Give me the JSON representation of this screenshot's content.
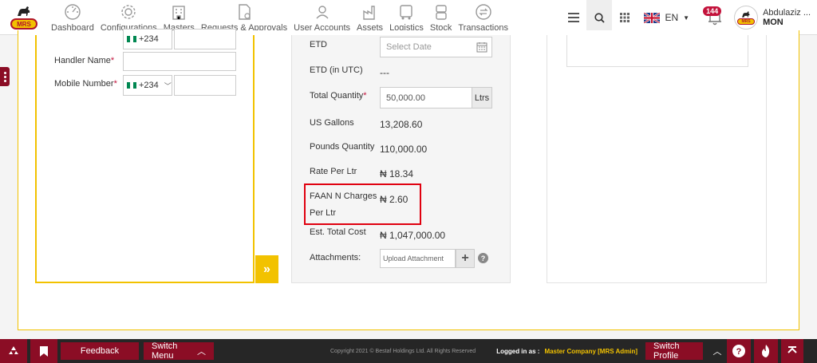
{
  "brand": {
    "logo_text": "MRS"
  },
  "nav": [
    {
      "label": "Dashboard",
      "icon": "dashboard-icon"
    },
    {
      "label": "Configurations",
      "icon": "gear-icon"
    },
    {
      "label": "Masters",
      "icon": "building-icon"
    },
    {
      "label": "Requests & Approvals",
      "icon": "document-check-icon"
    },
    {
      "label": "User Accounts",
      "icon": "users-icon"
    },
    {
      "label": "Assets",
      "icon": "factory-icon"
    },
    {
      "label": "Logistics",
      "icon": "truck-icon"
    },
    {
      "label": "Stock",
      "icon": "barrels-icon"
    },
    {
      "label": "Transactions",
      "icon": "exchange-icon"
    }
  ],
  "header": {
    "language": "EN",
    "notification_count": "144",
    "user_name": "Abdulaziz ...",
    "user_role": "MON"
  },
  "left_form": {
    "phone_code_top": "+234",
    "handler_name_label": "Handler Name",
    "mobile_number_label": "Mobile Number",
    "phone_code": "+234",
    "required_mark": "*"
  },
  "mid_form": {
    "etd_label": "ETD",
    "etd_placeholder": "Select Date",
    "etd_utc_label": "ETD (in UTC)",
    "etd_utc_value": "---",
    "total_quantity_label": "Total Quantity",
    "total_quantity_value": "50,000.00",
    "quantity_unit": "Ltrs",
    "us_gallons_label": "US Gallons",
    "us_gallons_value": "13,208.60",
    "pounds_quantity_label": "Pounds Quantity",
    "pounds_quantity_value": "110,000.00",
    "rate_label": "Rate Per Ltr",
    "rate_value": "₦ 18.34",
    "faan_label_1": "FAAN N Charges",
    "faan_label_2": "Per Ltr",
    "faan_value": "₦ 2.60",
    "est_total_label": "Est. Total Cost",
    "est_total_value": "₦ 1,047,000.00",
    "attachments_label": "Attachments:",
    "attachments_placeholder": "Upload Attachment"
  },
  "footer": {
    "feedback": "Feedback",
    "switch_menu": "Switch Menu",
    "copyright": "Copyright 2021 © Bestaf Holdings Ltd. All Rights Reserved",
    "logged_in_label": "Logged in as :",
    "logged_in_company": "Master Company [MRS Admin]",
    "switch_profile": "Switch Profile"
  },
  "colors": {
    "brand_maroon": "#8b0d25",
    "accent_yellow": "#f2c200",
    "highlight_red": "#e0000f",
    "footer_bg": "#262626"
  }
}
